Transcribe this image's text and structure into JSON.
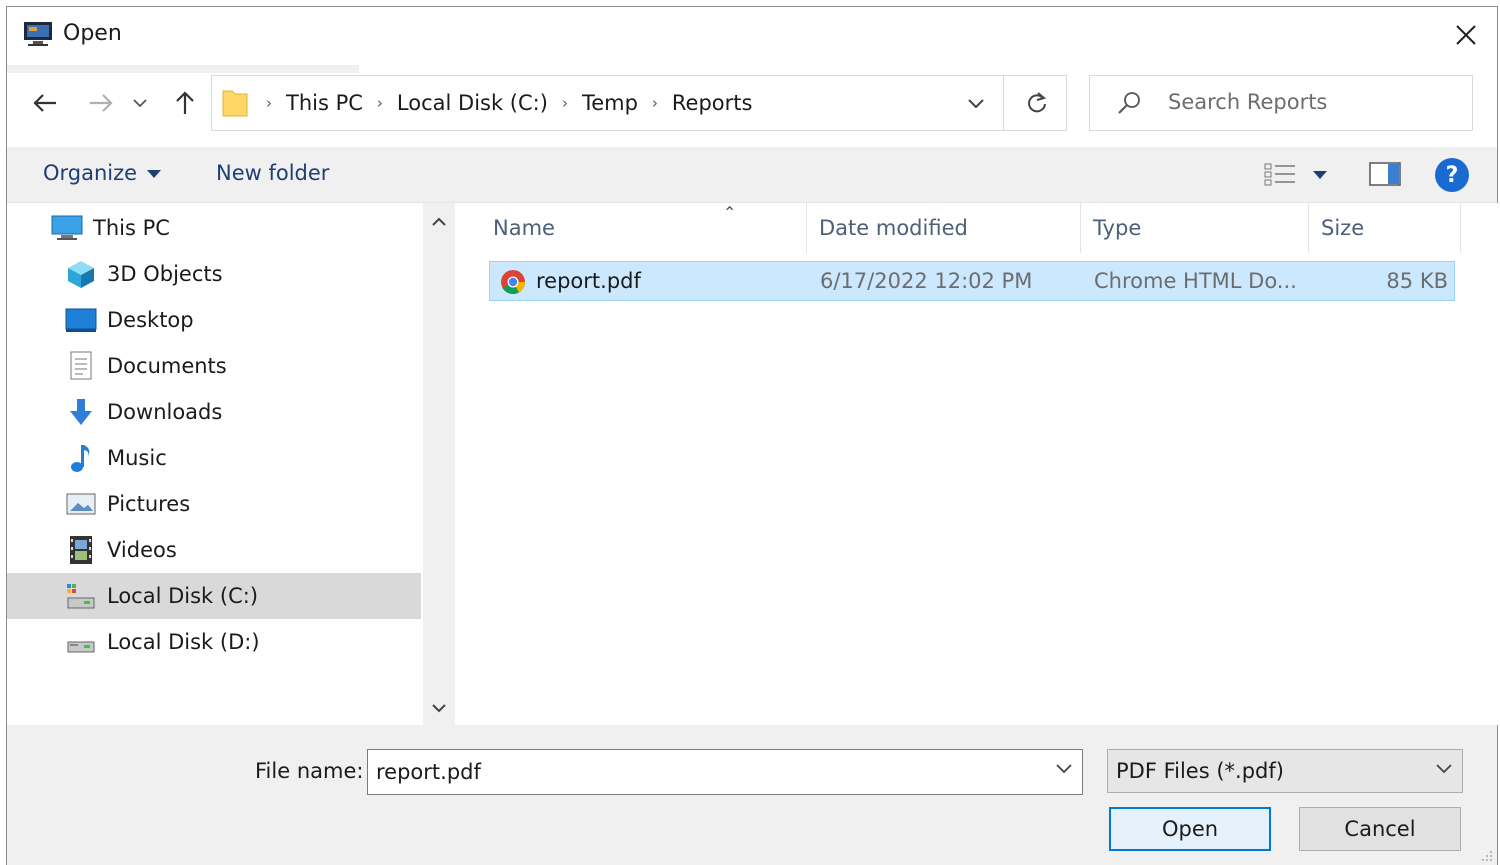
{
  "window": {
    "title": "Open",
    "app_icon": "app-icon",
    "close_icon": "close-icon"
  },
  "nav": {
    "back_icon": "back-arrow-icon",
    "forward_icon": "forward-arrow-icon",
    "recent_icon": "chevron-down-icon",
    "up_icon": "up-arrow-icon",
    "breadcrumbs": [
      "This PC",
      "Local Disk (C:)",
      "Temp",
      "Reports"
    ],
    "refresh_icon": "refresh-icon",
    "search_placeholder": "Search Reports"
  },
  "toolbar": {
    "organize": "Organize",
    "new_folder": "New folder",
    "help": "?"
  },
  "sidebar": {
    "items": [
      {
        "label": "This PC",
        "icon": "this-pc-icon"
      },
      {
        "label": "3D Objects",
        "icon": "3d-objects-icon"
      },
      {
        "label": "Desktop",
        "icon": "desktop-icon"
      },
      {
        "label": "Documents",
        "icon": "documents-icon"
      },
      {
        "label": "Downloads",
        "icon": "downloads-icon"
      },
      {
        "label": "Music",
        "icon": "music-icon"
      },
      {
        "label": "Pictures",
        "icon": "pictures-icon"
      },
      {
        "label": "Videos",
        "icon": "videos-icon"
      },
      {
        "label": "Local Disk (C:)",
        "icon": "drive-icon",
        "selected": true
      },
      {
        "label": "Local Disk (D:)",
        "icon": "drive-icon"
      }
    ]
  },
  "filelist": {
    "columns": [
      "Name",
      "Date modified",
      "Type",
      "Size"
    ],
    "rows": [
      {
        "name": "report.pdf",
        "date": "6/17/2022 12:02 PM",
        "type": "Chrome HTML Do...",
        "size": "85 KB",
        "selected": true
      }
    ]
  },
  "bottom": {
    "file_name_label": "File name:",
    "file_name_value": "report.pdf",
    "filter_value": "PDF Files (*.pdf)",
    "open_label": "Open",
    "cancel_label": "Cancel"
  },
  "colors": {
    "accent": "#0078d7",
    "selection": "#cce8ff",
    "link_blue": "#1f3f73"
  }
}
